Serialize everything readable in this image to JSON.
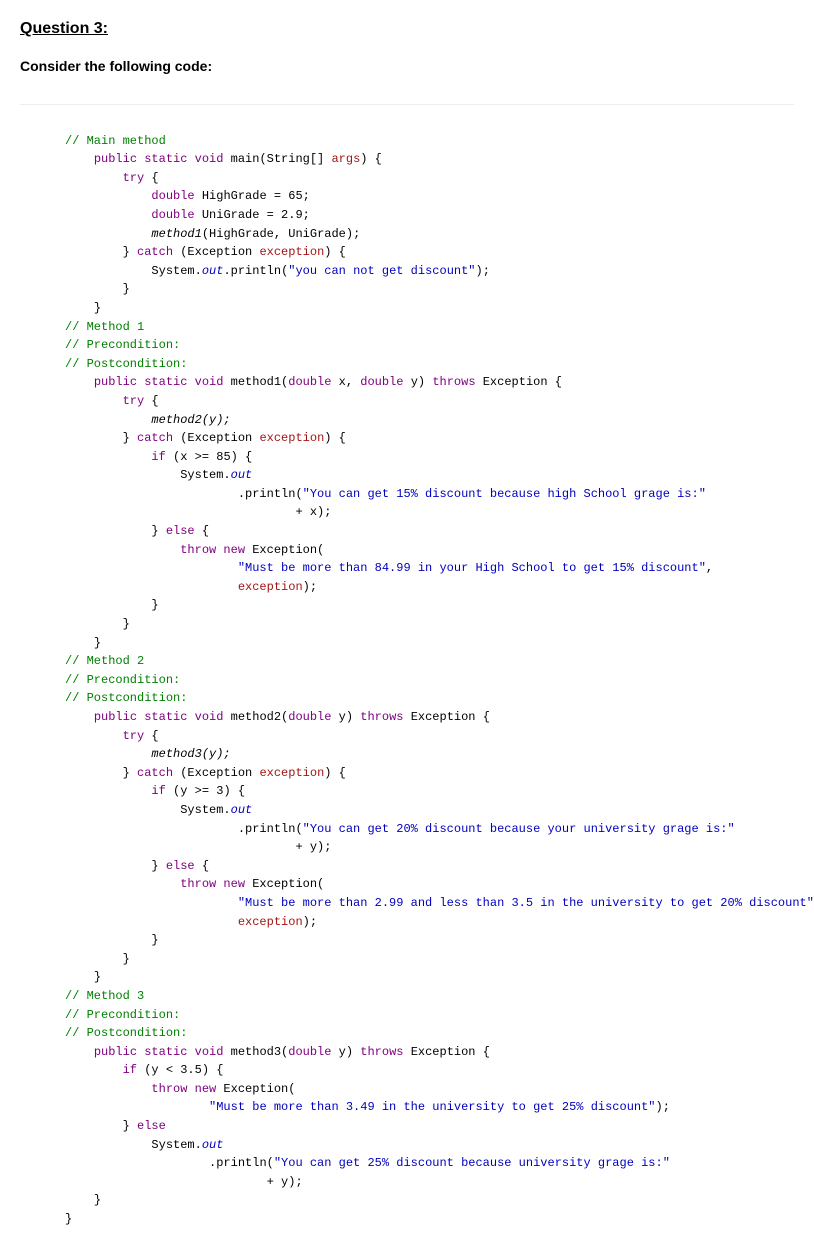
{
  "heading": "Question 3:",
  "prompt": "Consider the following code:",
  "code": {
    "c1": "// Main method",
    "c2_a": "public static void",
    "c2_b": " main(String[] ",
    "c2_c": "args",
    "c2_d": ") {",
    "c3": "try",
    "c3b": " {",
    "c4_a": "double",
    "c4_b": " HighGrade = 65;",
    "c5_a": "double",
    "c5_b": " UniGrade = 2.9;",
    "c6_a": "method1",
    "c6_b": "(HighGrade, UniGrade);",
    "c7_a": "} ",
    "c7_b": "catch",
    "c7_c": " (Exception ",
    "c7_d": "exception",
    "c7_e": ") {",
    "c8_a": "System.",
    "c8_b": "out",
    "c8_c": ".println(",
    "c8_d": "\"you can not get discount\"",
    "c8_e": ");",
    "c9": "}",
    "c10": "}",
    "c11": "// Method 1",
    "c12": "// Precondition:",
    "c13": "// Postcondition:",
    "c14_a": "public static void",
    "c14_b": " method1(",
    "c14_c": "double",
    "c14_d": " x, ",
    "c14_e": "double",
    "c14_f": " y) ",
    "c14_g": "throws",
    "c14_h": " Exception {",
    "c15_a": "try",
    "c15_b": " {",
    "c16": "method2(y);",
    "c17_a": "} ",
    "c17_b": "catch",
    "c17_c": " (Exception ",
    "c17_d": "exception",
    "c17_e": ") {",
    "c18_a": "if",
    "c18_b": " (x >= 85) {",
    "c19_a": "System.",
    "c19_b": "out",
    "c20_a": ".println(",
    "c20_b": "\"You can get 15% discount because high School grage is:\"",
    "c21": "+ x);",
    "c22_a": "} ",
    "c22_b": "else",
    "c22_c": " {",
    "c23_a": "throw new",
    "c23_b": " Exception(",
    "c24": "\"Must be more than 84.99 in your High School to get 15% discount\"",
    "c24b": ",",
    "c25_a": "exception",
    "c25_b": ");",
    "c26": "}",
    "c27": "}",
    "c28": "}",
    "c29": "// Method 2",
    "c30": "// Precondition:",
    "c31": "// Postcondition:",
    "c32_a": "public static void",
    "c32_b": " method2(",
    "c32_c": "double",
    "c32_d": " y) ",
    "c32_e": "throws",
    "c32_f": " Exception {",
    "c33_a": "try",
    "c33_b": " {",
    "c34": "method3(y);",
    "c35_a": "} ",
    "c35_b": "catch",
    "c35_c": " (Exception ",
    "c35_d": "exception",
    "c35_e": ") {",
    "c36_a": "if",
    "c36_b": " (y >= 3) {",
    "c37_a": "System.",
    "c37_b": "out",
    "c38_a": ".println(",
    "c38_b": "\"You can get 20% discount because your university grage is:\"",
    "c39": "+ y);",
    "c40_a": "} ",
    "c40_b": "else",
    "c40_c": " {",
    "c41_a": "throw new",
    "c41_b": " Exception(",
    "c42": "\"Must be more than 2.99 and less than 3.5 in the university to get 20% discount\"",
    "c42b": ",",
    "c43_a": "exception",
    "c43_b": ");",
    "c44": "}",
    "c45": "}",
    "c46": "}",
    "c47": "// Method 3",
    "c48": "// Precondition:",
    "c49": "// Postcondition:",
    "c50_a": "public static void",
    "c50_b": " method3(",
    "c50_c": "double",
    "c50_d": " y) ",
    "c50_e": "throws",
    "c50_f": " Exception {",
    "c51_a": "if",
    "c51_b": " (y < 3.5) {",
    "c52_a": "throw new",
    "c52_b": " Exception(",
    "c53": "\"Must be more than 3.49 in the university to get 25% discount\"",
    "c53b": ");",
    "c54_a": "} ",
    "c54_b": "else",
    "c55_a": "System.",
    "c55_b": "out",
    "c56_a": ".println(",
    "c56_b": "\"You can get 25% discount because university grage is:\"",
    "c57": "+ y);",
    "c58": "}",
    "c59": "}"
  }
}
